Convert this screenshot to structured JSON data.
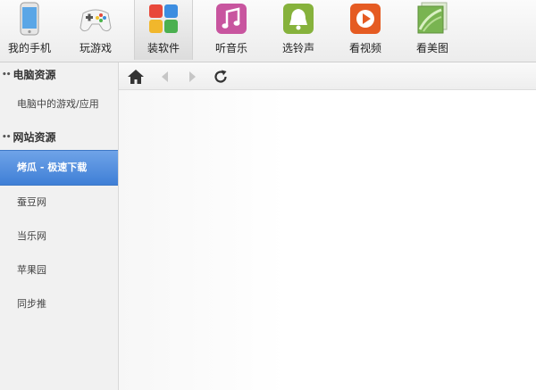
{
  "toolbar": {
    "items": [
      {
        "label": "我的手机",
        "icon": "phone-icon"
      },
      {
        "label": "玩游戏",
        "icon": "gamepad-icon"
      },
      {
        "label": "装软件",
        "icon": "apps-grid-icon",
        "active": true
      },
      {
        "label": "听音乐",
        "icon": "music-note-icon"
      },
      {
        "label": "选铃声",
        "icon": "bell-icon"
      },
      {
        "label": "看视频",
        "icon": "play-video-icon"
      },
      {
        "label": "看美图",
        "icon": "picture-icon"
      }
    ]
  },
  "sidebar": {
    "pc_section": {
      "title": "电脑资源"
    },
    "pc_items": [
      {
        "label": "电脑中的游戏/应用"
      }
    ],
    "web_section": {
      "title": "网站资源"
    },
    "web_items": [
      {
        "label": "烤瓜 - 极速下载",
        "active": true
      },
      {
        "label": "蚕豆网"
      },
      {
        "label": "当乐网"
      },
      {
        "label": "苹果园"
      },
      {
        "label": "同步推"
      }
    ]
  },
  "navbar": {
    "icons": [
      "home-icon",
      "back-arrow-icon",
      "forward-arrow-icon",
      "refresh-icon"
    ]
  },
  "colors": {
    "active_item": "#4a86d9",
    "toolbar_bg": "#f2f2f2",
    "sidebar_bg": "#f1f1f1"
  }
}
